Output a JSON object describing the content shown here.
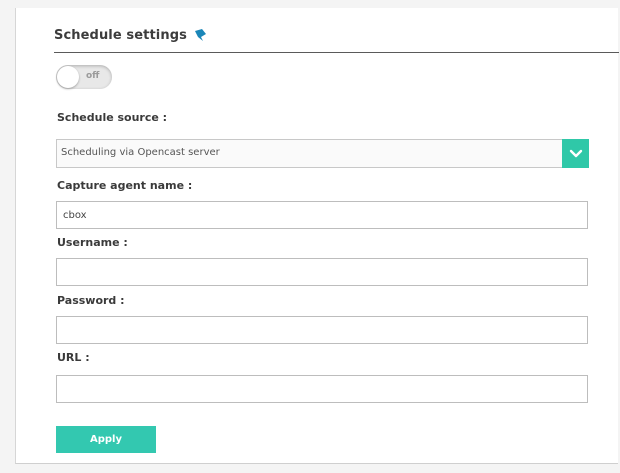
{
  "header": {
    "title": "Schedule settings"
  },
  "toggle": {
    "label": "off"
  },
  "schedule_source": {
    "label": "Schedule source :",
    "selected": "Scheduling via Opencast server"
  },
  "capture_agent": {
    "label": "Capture agent name :",
    "value": "cbox"
  },
  "username": {
    "label": "Username :",
    "value": ""
  },
  "password": {
    "label": "Password :",
    "value": ""
  },
  "url": {
    "label": "URL :",
    "value": ""
  },
  "apply_button": {
    "label": "Apply"
  },
  "colors": {
    "accent": "#2fc8a8",
    "icon": "#1a86b8"
  }
}
